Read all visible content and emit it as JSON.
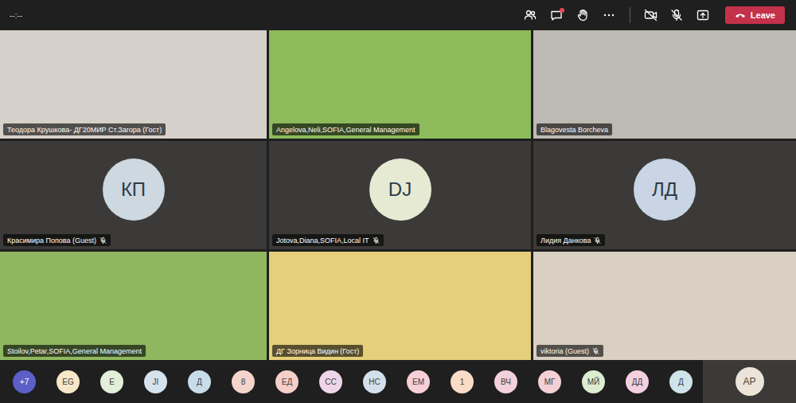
{
  "top_bar": {
    "timer": "--:--",
    "chat_unread": true,
    "camera_on": false,
    "mic_muted": true,
    "leave_button": "Leave"
  },
  "tiles": [
    {
      "name": "Теодора Крушкова- ДГ20МИР Ст.Загора (Гост)",
      "kind": "video",
      "muted": false,
      "color": "#d6d0ca"
    },
    {
      "name": "Angelova,Neli,SOFIA,General Management",
      "kind": "video",
      "muted": false,
      "color": "#8dbb5c"
    },
    {
      "name": "Blagovesta Borcheva",
      "kind": "video",
      "muted": false,
      "color": "#bdbab4"
    },
    {
      "name": "Красимира Попова (Guest)",
      "kind": "avatar",
      "initials": "КП",
      "muted": true,
      "color": "#cdd8e0"
    },
    {
      "name": "Jotova,Diana,SOFIA,Local IT",
      "kind": "avatar",
      "initials": "DJ",
      "muted": true,
      "color": "#e6ead2"
    },
    {
      "name": "Лидия Данкова",
      "kind": "avatar",
      "initials": "ЛД",
      "muted": true,
      "color": "#c9d5e4"
    },
    {
      "name": "Stoilov,Petar,SOFIA,General Management",
      "kind": "video",
      "muted": false,
      "color": "#8fb75f"
    },
    {
      "name": "ДГ Зорница Видин (Гост)",
      "kind": "video",
      "muted": false,
      "color": "#e6cf7a"
    },
    {
      "name": "viktoria (Guest)",
      "kind": "video",
      "muted": true,
      "color": "#d9cfc2"
    }
  ],
  "roster": {
    "overflow": "+7",
    "avatars": [
      {
        "initials": "EG",
        "color": "#f6e7c8"
      },
      {
        "initials": "E",
        "color": "#e3efd8"
      },
      {
        "initials": "JI",
        "color": "#d5e3ee"
      },
      {
        "initials": "Д",
        "color": "#c9dce9"
      },
      {
        "initials": "8",
        "color": "#f5d5cb"
      },
      {
        "initials": "ЕД",
        "color": "#f6cfc9"
      },
      {
        "initials": "СС",
        "color": "#eed6e8"
      },
      {
        "initials": "НС",
        "color": "#d3e0ec"
      },
      {
        "initials": "ЕМ",
        "color": "#f6cfd8"
      },
      {
        "initials": "1",
        "color": "#f8dcc8"
      },
      {
        "initials": "ВЧ",
        "color": "#f3d1dc"
      },
      {
        "initials": "МГ",
        "color": "#f3cfd6"
      },
      {
        "initials": "МЙ",
        "color": "#dcedd1"
      },
      {
        "initials": "ДД",
        "color": "#f3d0df"
      },
      {
        "initials": "Д",
        "color": "#cfe3ea"
      }
    ]
  },
  "self_view": {
    "initials": "AP",
    "color": "#ece4d8"
  }
}
